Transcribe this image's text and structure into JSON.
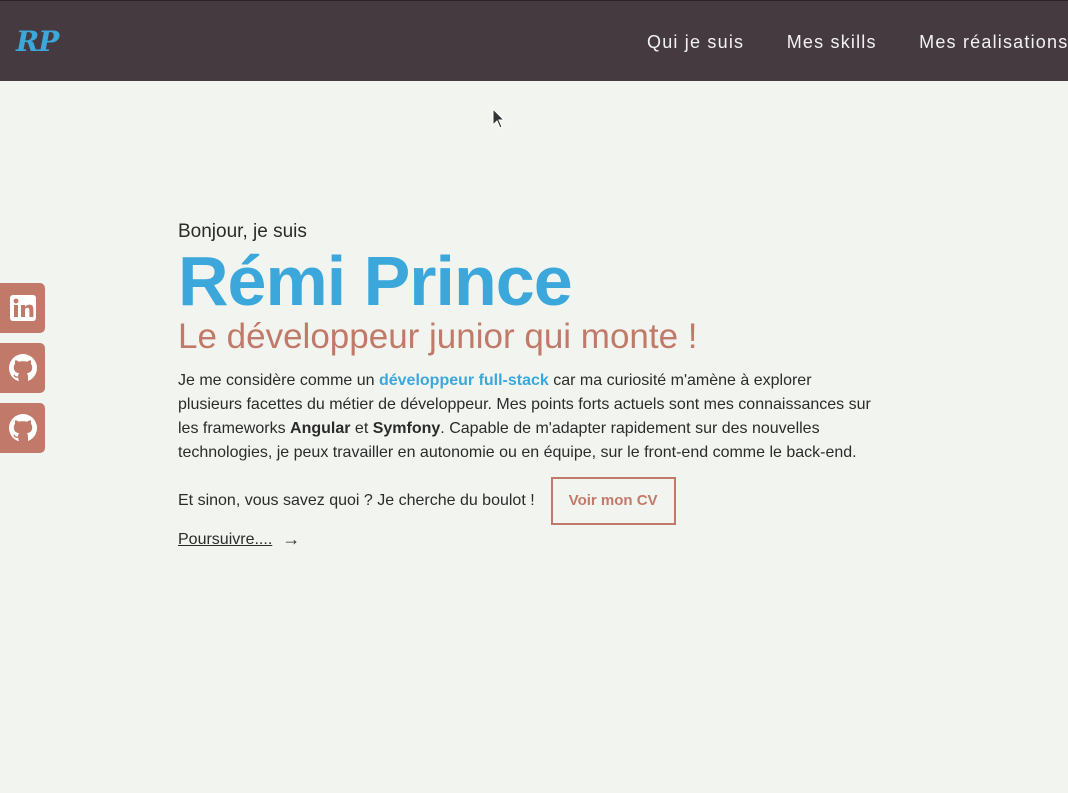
{
  "header": {
    "logo": "RP",
    "nav": [
      "Qui je suis",
      "Mes skills",
      "Mes réalisations"
    ]
  },
  "social": {
    "items": [
      "linkedin-icon",
      "github-icon",
      "github-icon"
    ]
  },
  "hero": {
    "greeting": "Bonjour, je suis",
    "name": "Rémi Prince",
    "subtitle": "Le développeur junior qui monte !",
    "desc": {
      "p1": "Je me considère comme un ",
      "highlight": "développeur full-stack",
      "p2": " car ma curiosité m'amène à explorer plusieurs facettes du métier de développeur. Mes points forts actuels sont mes connaissances sur les frameworks ",
      "fw1": "Angular",
      "p3": " et ",
      "fw2": "Symfony",
      "p4": ". Capable de m'adapter rapidement sur des nouvelles technologies, je peux travailler en autonomie ou en équipe, sur le front-end comme le back-end."
    },
    "cv_text": "Et sinon, vous savez quoi ? Je cherche du boulot !",
    "cv_button": "Voir mon CV",
    "more_link": "Poursuivre....",
    "more_arrow": "→"
  },
  "colors": {
    "navbar": "#453a3f",
    "accent_blue": "#3ba7db",
    "accent_terracotta": "#c17a69",
    "background": "#f2f5ef"
  }
}
